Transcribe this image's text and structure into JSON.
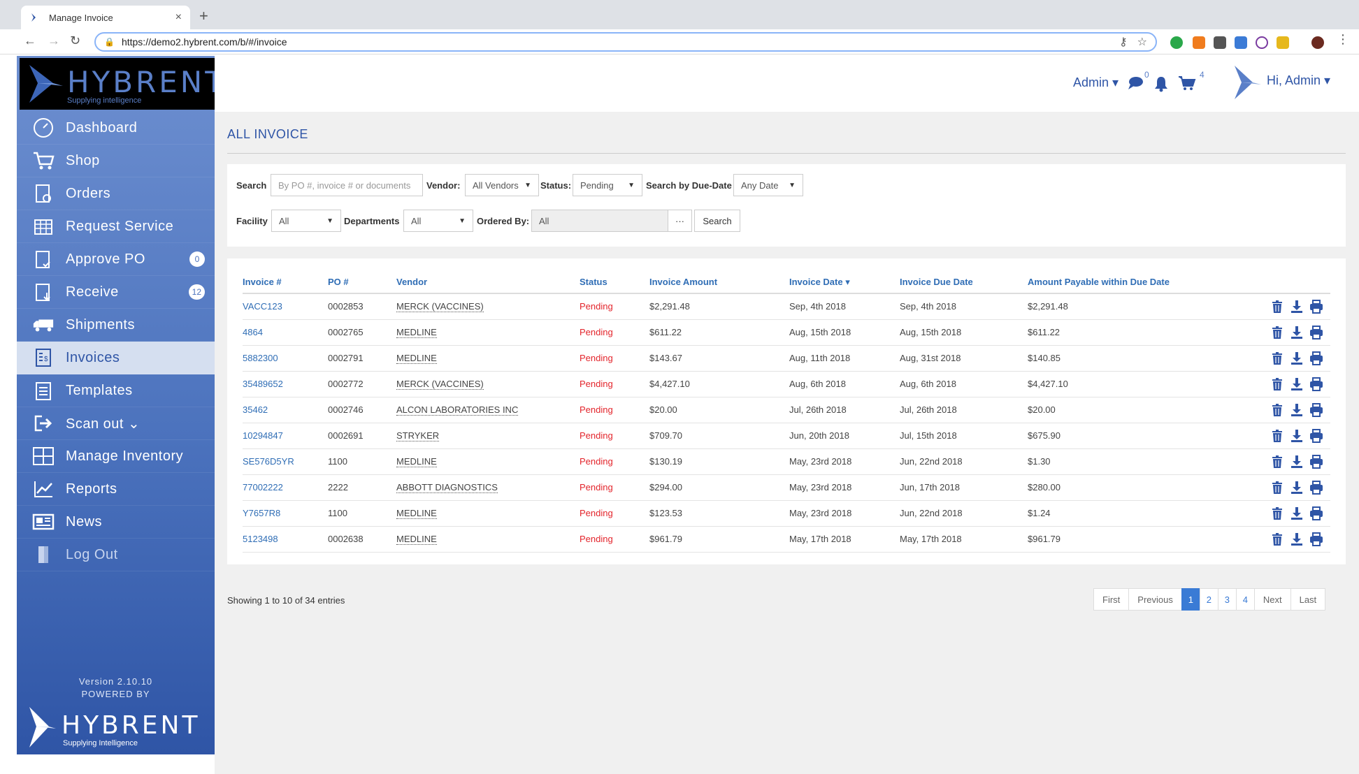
{
  "browser": {
    "tab_title": "Manage Invoice",
    "url": "https://demo2.hybrent.com/b/#/invoice"
  },
  "brand": {
    "name": "HYBRENT",
    "tagline_top": "Supplying intelligence",
    "tagline_bottom": "Supplying Intelligence"
  },
  "sidebar": {
    "items": [
      {
        "label": "Dashboard",
        "icon": "dashboard-icon"
      },
      {
        "label": "Shop",
        "icon": "cart-icon"
      },
      {
        "label": "Orders",
        "icon": "orders-icon"
      },
      {
        "label": "Request Service",
        "icon": "request-service-icon"
      },
      {
        "label": "Approve PO",
        "icon": "approve-icon",
        "badge": "0"
      },
      {
        "label": "Receive",
        "icon": "receive-icon",
        "badge": "12"
      },
      {
        "label": "Shipments",
        "icon": "truck-icon"
      },
      {
        "label": "Invoices",
        "icon": "invoice-icon",
        "active": true
      },
      {
        "label": "Templates",
        "icon": "templates-icon"
      },
      {
        "label": "Scan out ⌄",
        "icon": "scan-out-icon"
      },
      {
        "label": "Manage Inventory",
        "icon": "inventory-icon"
      },
      {
        "label": "Reports",
        "icon": "reports-icon"
      },
      {
        "label": "News",
        "icon": "news-icon"
      },
      {
        "label": "Log Out",
        "icon": "logout-icon"
      }
    ],
    "version": "Version 2.10.10",
    "powered_by": "POWERED BY"
  },
  "header": {
    "admin_label": "Admin ▾",
    "chat_count": "0",
    "cart_count": "4",
    "greeting": "Hi, Admin ▾"
  },
  "page": {
    "title": "ALL INVOICE"
  },
  "filters": {
    "search_label": "Search",
    "search_placeholder": "By PO #, invoice # or documents",
    "vendor_label": "Vendor:",
    "vendor_value": "All Vendors",
    "status_label": "Status:",
    "status_value": "Pending",
    "due_label": "Search by Due-Date",
    "due_value": "Any Date",
    "facility_label": "Facility",
    "facility_value": "All",
    "departments_label": "Departments",
    "departments_value": "All",
    "ordered_by_label": "Ordered By:",
    "ordered_by_value": "All",
    "more_label": "···",
    "search_button": "Search"
  },
  "table": {
    "columns": [
      "Invoice #",
      "PO #",
      "Vendor",
      "Status",
      "Invoice Amount",
      "Invoice Date ▾",
      "Invoice Due Date",
      "Amount Payable within Due Date",
      ""
    ],
    "rows": [
      {
        "invoice": "VACC123",
        "po": "0002853",
        "vendor": "MERCK (VACCINES)",
        "status": "Pending",
        "amount": "$2,291.48",
        "date": "Sep, 4th 2018",
        "due": "Sep, 4th 2018",
        "payable": "$2,291.48"
      },
      {
        "invoice": "4864",
        "po": "0002765",
        "vendor": "MEDLINE",
        "status": "Pending",
        "amount": "$611.22",
        "date": "Aug, 15th 2018",
        "due": "Aug, 15th 2018",
        "payable": "$611.22"
      },
      {
        "invoice": "5882300",
        "po": "0002791",
        "vendor": "MEDLINE",
        "status": "Pending",
        "amount": "$143.67",
        "date": "Aug, 11th 2018",
        "due": "Aug, 31st 2018",
        "payable": "$140.85"
      },
      {
        "invoice": "35489652",
        "po": "0002772",
        "vendor": "MERCK (VACCINES)",
        "status": "Pending",
        "amount": "$4,427.10",
        "date": "Aug, 6th 2018",
        "due": "Aug, 6th 2018",
        "payable": "$4,427.10"
      },
      {
        "invoice": "35462",
        "po": "0002746",
        "vendor": "ALCON LABORATORIES INC",
        "status": "Pending",
        "amount": "$20.00",
        "date": "Jul, 26th 2018",
        "due": "Jul, 26th 2018",
        "payable": "$20.00"
      },
      {
        "invoice": "10294847",
        "po": "0002691",
        "vendor": "STRYKER",
        "status": "Pending",
        "amount": "$709.70",
        "date": "Jun, 20th 2018",
        "due": "Jul, 15th 2018",
        "payable": "$675.90"
      },
      {
        "invoice": "SE576D5YR",
        "po": "1100",
        "vendor": "MEDLINE",
        "status": "Pending",
        "amount": "$130.19",
        "date": "May, 23rd 2018",
        "due": "Jun, 22nd 2018",
        "payable": "$1.30"
      },
      {
        "invoice": "77002222",
        "po": "2222",
        "vendor": "ABBOTT DIAGNOSTICS",
        "status": "Pending",
        "amount": "$294.00",
        "date": "May, 23rd 2018",
        "due": "Jun, 17th 2018",
        "payable": "$280.00"
      },
      {
        "invoice": "Y7657R8",
        "po": "1100",
        "vendor": "MEDLINE",
        "status": "Pending",
        "amount": "$123.53",
        "date": "May, 23rd 2018",
        "due": "Jun, 22nd 2018",
        "payable": "$1.24"
      },
      {
        "invoice": "5123498",
        "po": "0002638",
        "vendor": "MEDLINE",
        "status": "Pending",
        "amount": "$961.79",
        "date": "May, 17th 2018",
        "due": "May, 17th 2018",
        "payable": "$961.79"
      }
    ]
  },
  "footer": {
    "showing": "Showing 1 to 10 of 34 entries",
    "pager": [
      "First",
      "Previous",
      "1",
      "2",
      "3",
      "4",
      "Next",
      "Last"
    ],
    "active_page": "1"
  },
  "colors": {
    "brand_blue": "#2f55a6",
    "link_blue": "#2f6db5",
    "pending_red": "#e3242b"
  }
}
